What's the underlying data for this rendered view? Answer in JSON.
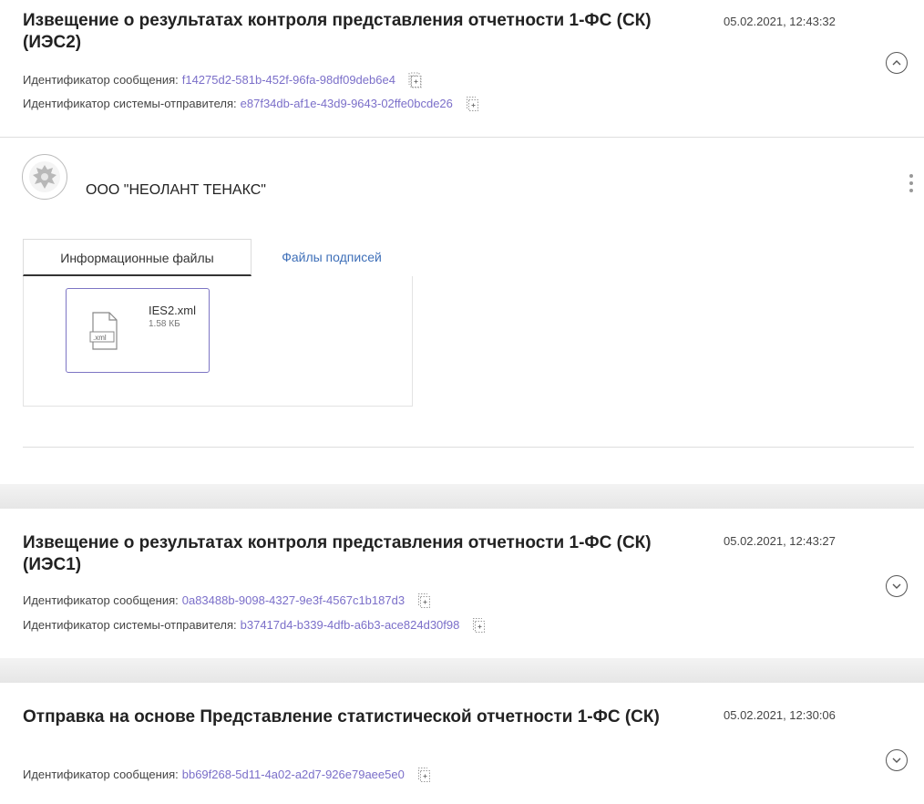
{
  "messages": [
    {
      "title": "Извещение о результатах контроля представления отчетности 1-ФС (СК) (ИЭС2)",
      "date": "05.02.2021, 12:43:32",
      "message_id_label": "Идентификатор сообщения:",
      "message_id": "f14275d2-581b-452f-96fa-98df09deb6e4",
      "sender_id_label": "Идентификатор системы-отправителя:",
      "sender_id": "e87f34db-af1e-43d9-9643-02ffe0bcde26",
      "expanded": true
    },
    {
      "title": "Извещение о результатах контроля представления отчетности 1-ФС (СК) (ИЭС1)",
      "date": "05.02.2021, 12:43:27",
      "message_id_label": "Идентификатор сообщения:",
      "message_id": "0a83488b-9098-4327-9e3f-4567c1b187d3",
      "sender_id_label": "Идентификатор системы-отправителя:",
      "sender_id": "b37417d4-b339-4dfb-a6b3-ace824d30f98",
      "expanded": false
    },
    {
      "title": "Отправка на основе Представление статистической отчетности 1-ФС (СК)",
      "date": "05.02.2021, 12:30:06",
      "message_id_label": "Идентификатор сообщения:",
      "message_id": "bb69f268-5d11-4a02-a2d7-926e79aee5e0",
      "expanded": false
    }
  ],
  "expanded_panel": {
    "org_name": "ООО \"НЕОЛАНТ ТЕНАКС\"",
    "tabs": [
      {
        "label": "Информационные файлы",
        "active": true
      },
      {
        "label": "Файлы подписей",
        "active": false
      }
    ],
    "files": [
      {
        "name": "IES2.xml",
        "size": "1.58 КБ",
        "ext_label": ".xml"
      }
    ]
  },
  "colors": {
    "link_value": "#7b6fc9",
    "tab_link": "#3e6fb8",
    "file_card_border": "#7d75c4"
  },
  "icons": {
    "copy": "copy-icon",
    "toggle_collapse": "chevron-up-icon",
    "toggle_expand": "chevron-down-icon",
    "kebab": "more-vertical-icon",
    "avatar": "emblem-icon",
    "file": "xml-file-icon"
  }
}
